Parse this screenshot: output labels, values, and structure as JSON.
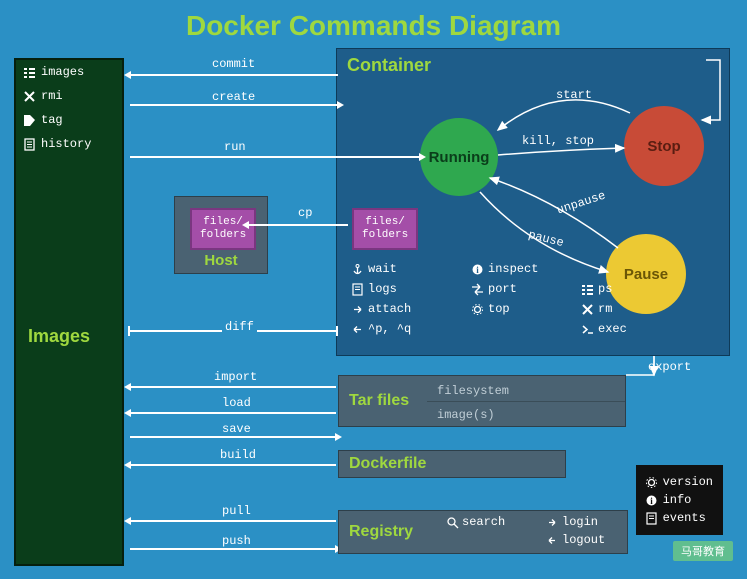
{
  "title": "Docker Commands Diagram",
  "images_panel": {
    "title": "Images",
    "items": [
      {
        "icon": "list",
        "label": "images"
      },
      {
        "icon": "x",
        "label": "rmi"
      },
      {
        "icon": "tag",
        "label": "tag"
      },
      {
        "icon": "doc",
        "label": "history"
      }
    ]
  },
  "container_panel": {
    "title": "Container",
    "states": {
      "running": "Running",
      "stop": "Stop",
      "pause": "Pause"
    },
    "files_label": "files/\nfolders",
    "commands": [
      {
        "icon": "anchor",
        "label": "wait"
      },
      {
        "icon": "info",
        "label": "inspect"
      },
      {
        "icon": "blank",
        "label": ""
      },
      {
        "icon": "doc",
        "label": "logs"
      },
      {
        "icon": "swap",
        "label": "port"
      },
      {
        "icon": "list",
        "label": "ps"
      },
      {
        "icon": "enter",
        "label": "attach"
      },
      {
        "icon": "gear",
        "label": "top"
      },
      {
        "icon": "x",
        "label": "rm"
      },
      {
        "icon": "exit",
        "label": "^p, ^q"
      },
      {
        "icon": "blank",
        "label": ""
      },
      {
        "icon": "prompt",
        "label": "exec"
      }
    ],
    "grid_order": [
      "wait",
      "inspect",
      "",
      "logs",
      "port",
      "ps",
      "attach",
      "top",
      "rm",
      "^p, ^q",
      "",
      "exec"
    ]
  },
  "host_panel": {
    "title": "Host"
  },
  "arrows": {
    "commit": "commit",
    "create": "create",
    "run": "run",
    "cp": "cp",
    "start": "start",
    "kill_stop": "kill, stop",
    "unpause": "unpause",
    "pause": "pause",
    "diff": "diff",
    "import": "import",
    "load": "load",
    "save": "save",
    "build": "build",
    "pull": "pull",
    "push": "push",
    "export": "export"
  },
  "tar_panel": {
    "title": "Tar files",
    "row1": "filesystem",
    "row2": "image(s)"
  },
  "dockerfile_panel": {
    "title": "Dockerfile"
  },
  "registry_panel": {
    "title": "Registry",
    "commands": [
      {
        "icon": "search",
        "label": "search"
      },
      {
        "icon": "login",
        "label": "login"
      },
      {
        "icon": "blank",
        "label": ""
      },
      {
        "icon": "logout",
        "label": "logout"
      }
    ]
  },
  "meta_panel": [
    {
      "icon": "gear",
      "label": "version"
    },
    {
      "icon": "info",
      "label": "info"
    },
    {
      "icon": "doc",
      "label": "events"
    }
  ],
  "watermark": "马哥教育"
}
